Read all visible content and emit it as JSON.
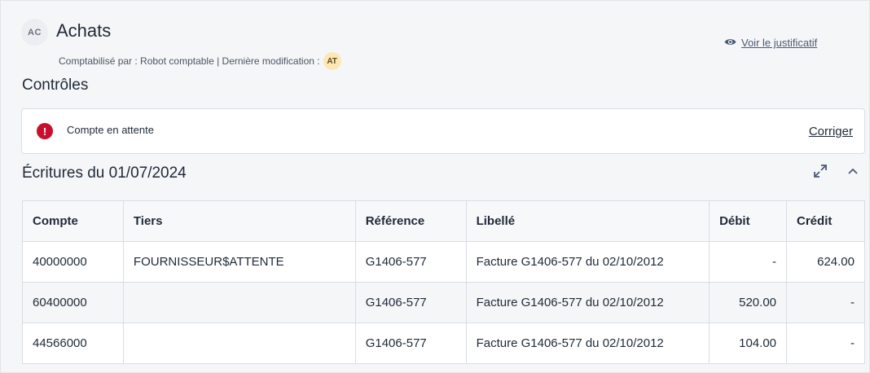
{
  "header": {
    "avatar_initials": "AC",
    "title": "Achats",
    "meta_text": "Comptabilisé par : Robot comptable | Dernière modification :",
    "modifier_initials": "AT",
    "voir_label": "Voir le justificatif"
  },
  "controls": {
    "section_title": "Contrôles",
    "items": [
      {
        "message": "Compte en attente",
        "action": "Corriger"
      }
    ]
  },
  "entries": {
    "section_title": "Écritures du 01/07/2024",
    "columns": [
      "Compte",
      "Tiers",
      "Référence",
      "Libellé",
      "Débit",
      "Crédit"
    ],
    "rows": [
      [
        "40000000",
        "FOURNISSEUR$ATTENTE",
        "G1406-577",
        "Facture G1406-577 du 02/10/2012",
        "-",
        "624.00"
      ],
      [
        "60400000",
        "",
        "G1406-577",
        "Facture G1406-577 du 02/10/2012",
        "520.00",
        "-"
      ],
      [
        "44566000",
        "",
        "G1406-577",
        "Facture G1406-577 du 02/10/2012",
        "104.00",
        "-"
      ]
    ]
  },
  "colors": {
    "error": "#c8102e",
    "badge_at": "#fde7b5"
  }
}
